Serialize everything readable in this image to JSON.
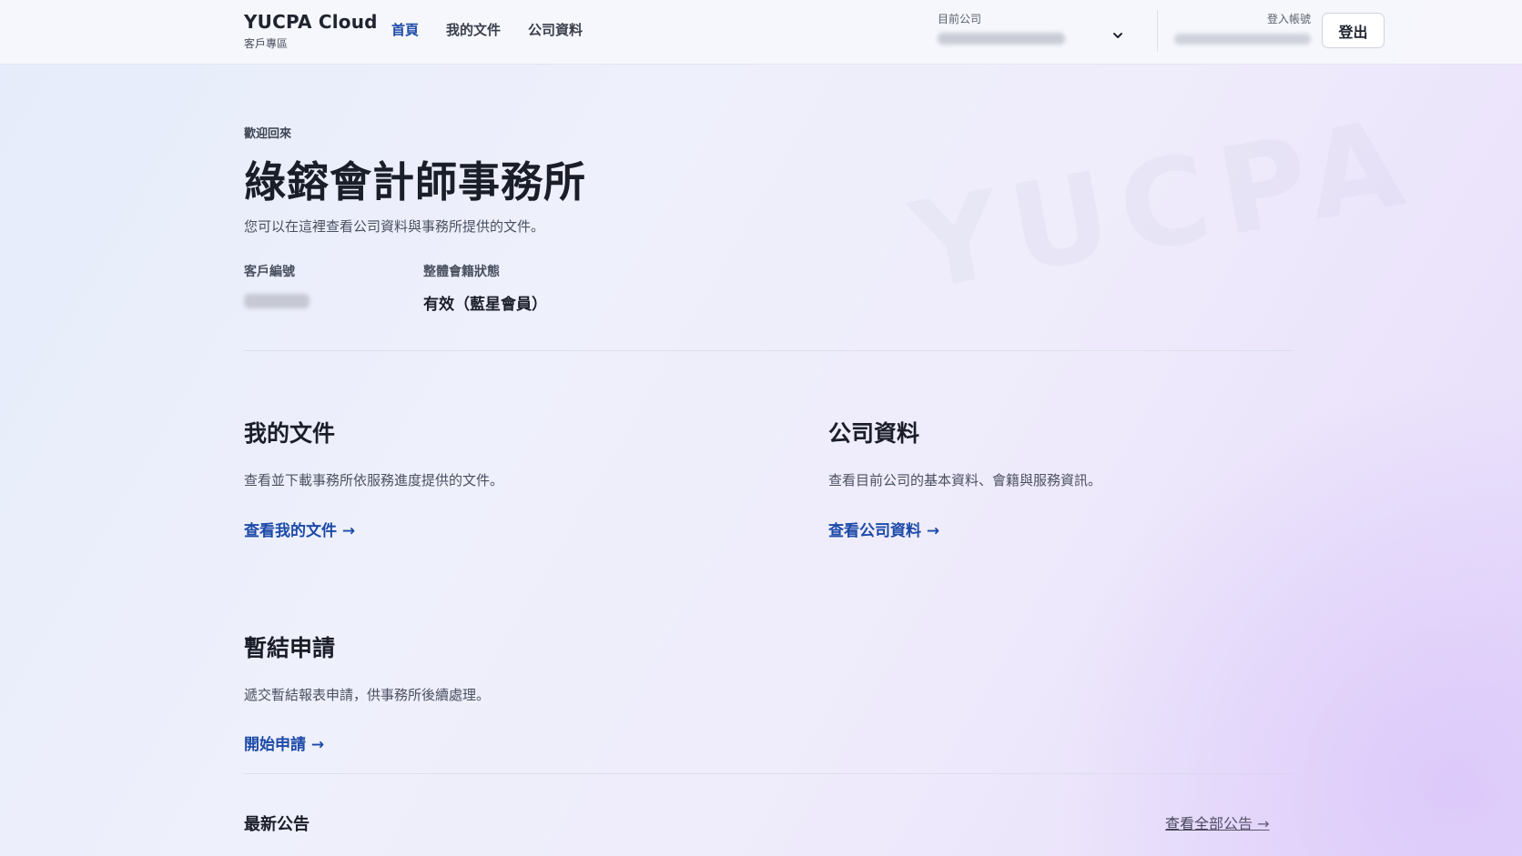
{
  "brand": {
    "title": "YUCPA Cloud",
    "subtitle": "客戶專區"
  },
  "nav": {
    "items": [
      {
        "label": "首頁",
        "active": true
      },
      {
        "label": "我的文件",
        "active": false
      },
      {
        "label": "公司資料",
        "active": false
      }
    ]
  },
  "company_selector": {
    "label": "目前公司",
    "icon": "chevron-down-icon"
  },
  "account": {
    "label": "登入帳號"
  },
  "logout_label": "登出",
  "watermark": "YUCPA",
  "hero": {
    "welcome": "歡迎回來",
    "firm_name": "綠鎔會計師事務所",
    "intro": "您可以在這裡查看公司資料與事務所提供的文件。",
    "client_id_label": "客戶編號",
    "membership_label": "整體會籍狀態",
    "membership_value": "有效（藍星會員）"
  },
  "cards": {
    "documents": {
      "title": "我的文件",
      "desc": "查看並下載事務所依服務進度提供的文件。",
      "link": "查看我的文件 →"
    },
    "company": {
      "title": "公司資料",
      "desc": "查看目前公司的基本資料、會籍與服務資訊。",
      "link": "查看公司資料 →"
    },
    "closing": {
      "title": "暫結申請",
      "desc": "遞交暫結報表申請，供事務所後續處理。",
      "link": "開始申請 →"
    }
  },
  "announcements": {
    "title": "最新公告",
    "view_all": "查看全部公告 →"
  },
  "colors": {
    "accent": "#1d4aa8",
    "text": "#1f2430"
  }
}
